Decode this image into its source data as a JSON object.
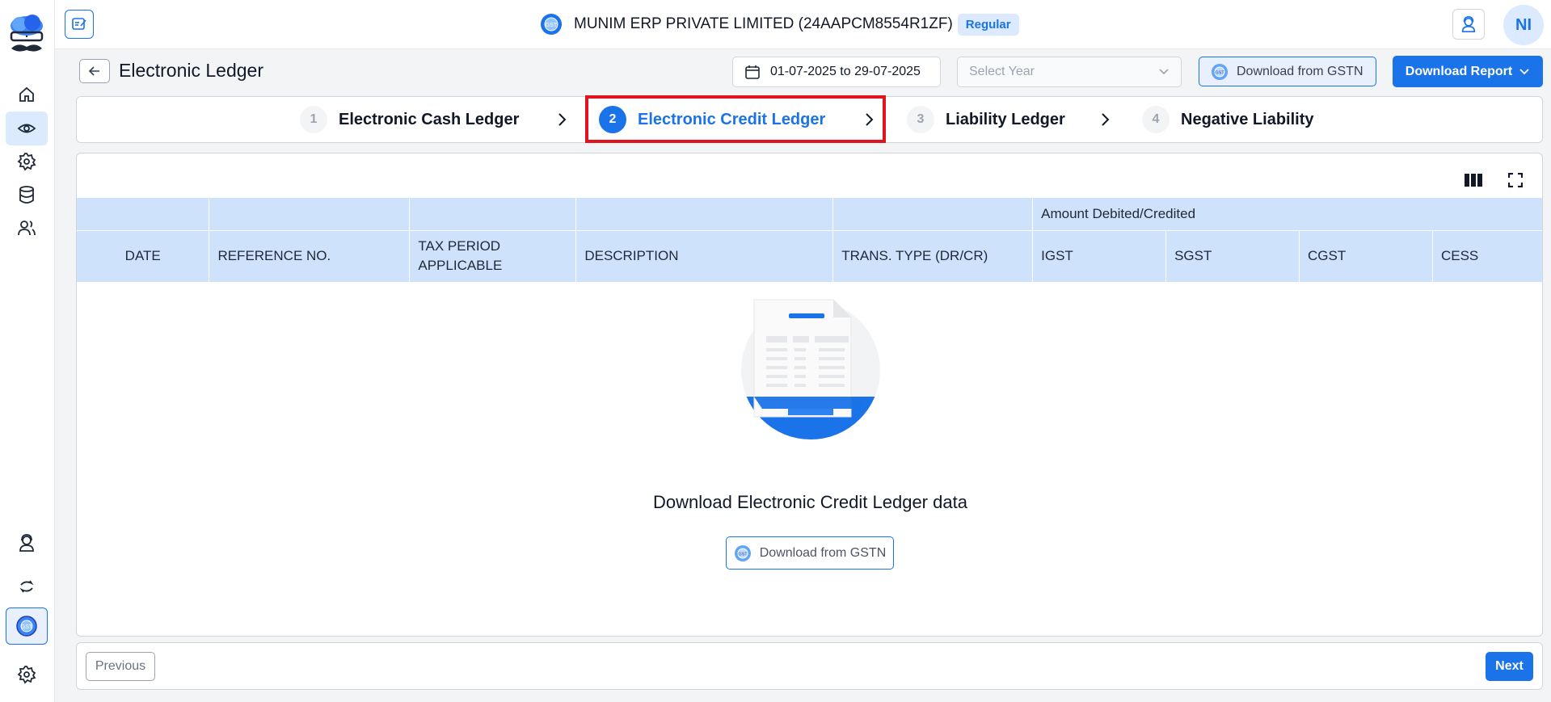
{
  "header": {
    "company_name": "MUNIM ERP PRIVATE LIMITED (24AAPCM8554R1ZF)",
    "registration_badge": "Regular",
    "avatar_initials": "NI"
  },
  "sidebar": {
    "items": [
      {
        "name": "home",
        "icon": "home-icon"
      },
      {
        "name": "view",
        "icon": "eye-icon",
        "active": true
      },
      {
        "name": "settings",
        "icon": "gear-icon"
      },
      {
        "name": "database",
        "icon": "database-icon"
      },
      {
        "name": "users",
        "icon": "users-icon"
      }
    ],
    "bottom_items": [
      "support-icon",
      "sync-icon",
      "gst-icon",
      "gear-icon"
    ]
  },
  "toolbar": {
    "page_title": "Electronic Ledger",
    "date_range": "01-07-2025 to 29-07-2025",
    "year_placeholder": "Select Year",
    "download_gstn_label": "Download from GSTN",
    "download_report_label": "Download Report"
  },
  "steps": [
    {
      "number": "1",
      "label": "Electronic Cash Ledger",
      "active": false
    },
    {
      "number": "2",
      "label": "Electronic Credit Ledger",
      "active": true
    },
    {
      "number": "3",
      "label": "Liability Ledger",
      "active": false
    },
    {
      "number": "4",
      "label": "Negative Liability",
      "active": false
    }
  ],
  "table": {
    "group_header": "Amount Debited/Credited",
    "columns": [
      "DATE",
      "REFERENCE NO.",
      "TAX PERIOD APPLICABLE",
      "DESCRIPTION",
      "TRANS. TYPE (DR/CR)",
      "IGST",
      "SGST",
      "CGST",
      "CESS"
    ]
  },
  "empty_state": {
    "message": "Download Electronic Credit Ledger data",
    "button_label": "Download from GSTN"
  },
  "footer": {
    "previous_label": "Previous",
    "next_label": "Next"
  },
  "colors": {
    "primary": "#1a73e8",
    "header_bg": "#cfe2fb",
    "highlight": "#e0141e"
  }
}
